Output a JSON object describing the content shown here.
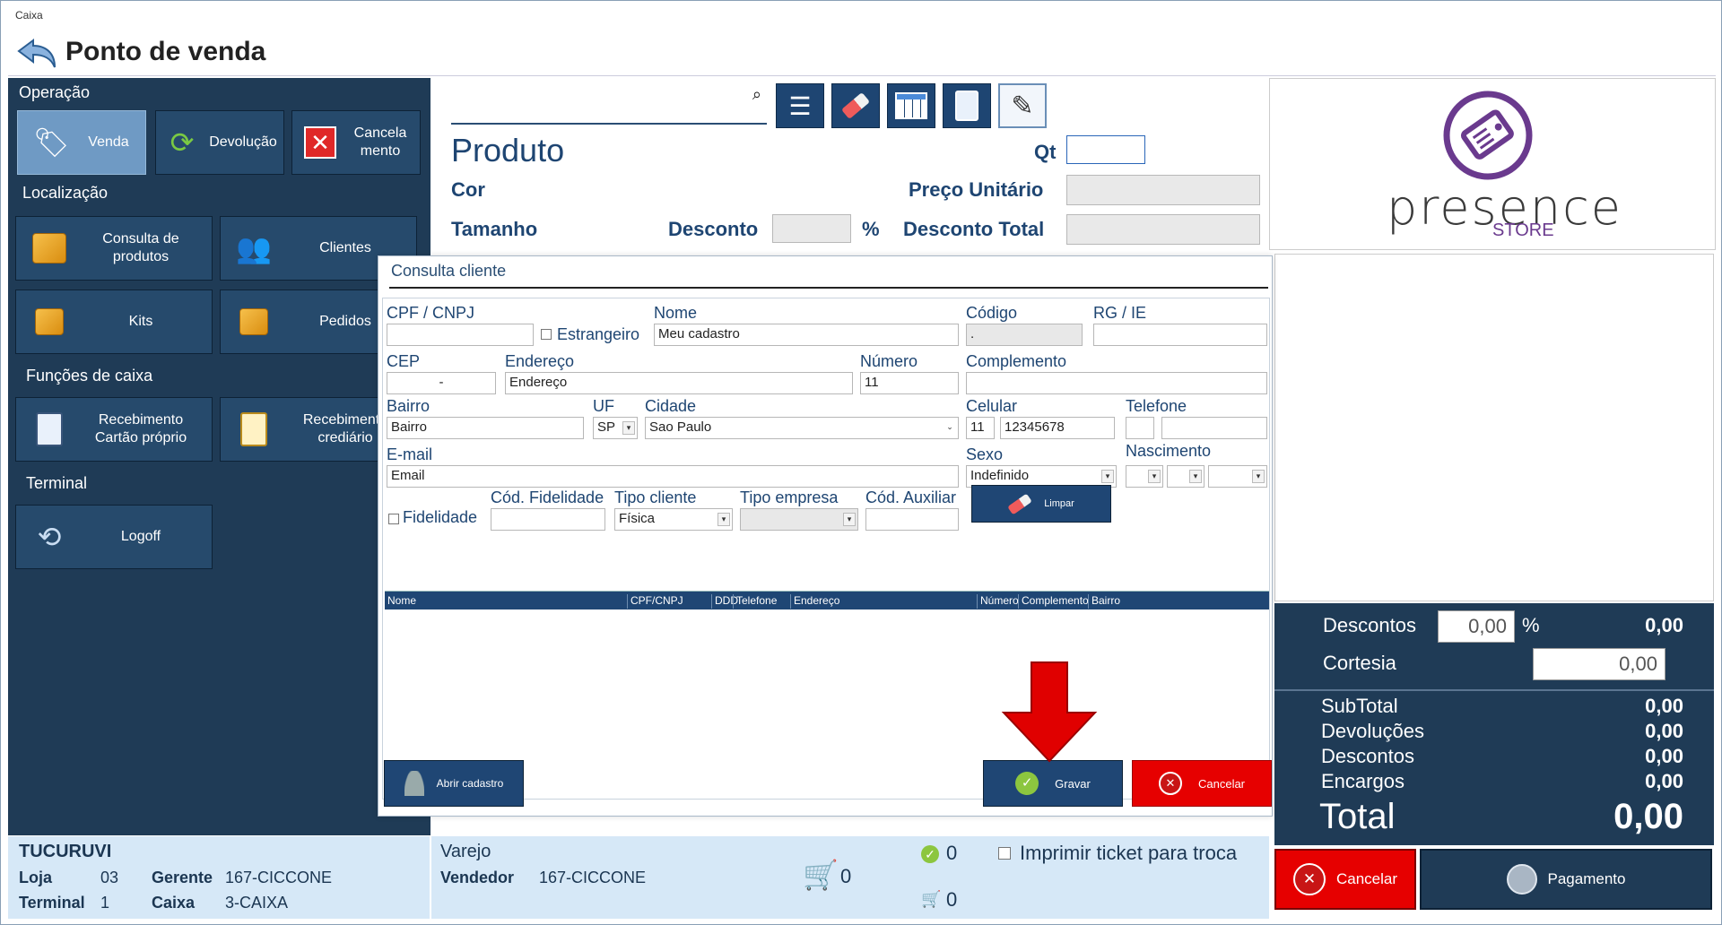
{
  "window": {
    "title": "Caixa"
  },
  "header": {
    "title": "Ponto de venda"
  },
  "left": {
    "operacao": "Operação",
    "venda": "Venda",
    "devolucao": "Devolução",
    "cancelamento_1": "Cancela",
    "cancelamento_2": "mento",
    "localizacao": "Localização",
    "consulta_1": "Consulta de",
    "consulta_2": "produtos",
    "clientes": "Clientes",
    "kits": "Kits",
    "pedidos": "Pedidos",
    "funcoes": "Funções de caixa",
    "receb_cartao_1": "Recebimento",
    "receb_cartao_2": "Cartão próprio",
    "receb_cred_1": "Recebimento",
    "receb_cred_2": "crediário",
    "terminal": "Terminal",
    "logoff": "Logoff"
  },
  "product": {
    "search_placeholder": "",
    "produto": "Produto",
    "qt": "Qt",
    "cor": "Cor",
    "preco_unitario": "Preço Unitário",
    "tamanho": "Tamanho",
    "desconto": "Desconto",
    "pct": "%",
    "desconto_total": "Desconto Total"
  },
  "logo": {
    "brand": "presence",
    "sub": "STORE",
    "color": "#6a3a8e"
  },
  "totals": {
    "descontos_label": "Descontos",
    "descontos_input": "0,00",
    "pct": "%",
    "descontos_value": "0,00",
    "cortesia_label": "Cortesia",
    "cortesia_input": "0,00",
    "subtotal_label": "SubTotal",
    "subtotal": "0,00",
    "devolucoes_label": "Devoluções",
    "devolucoes": "0,00",
    "descontos2_label": "Descontos",
    "descontos2": "0,00",
    "encargos_label": "Encargos",
    "encargos": "0,00",
    "total_label": "Total",
    "total": "0,00",
    "cancelar": "Cancelar",
    "pagamento": "Pagamento"
  },
  "footer": {
    "loja_nome": "TUCURUVI",
    "loja_label": "Loja",
    "loja": "03",
    "gerente_label": "Gerente",
    "gerente": "167-CICCONE",
    "terminal_label": "Terminal",
    "terminal": "1",
    "caixa_label": "Caixa",
    "caixa": "3-CAIXA",
    "varejo": "Varejo",
    "vendedor_label": "Vendedor",
    "vendedor": "167-CICCONE",
    "cart_count": "0",
    "ok_count": "0",
    "cart2_count": "0",
    "imprimir": "Imprimir ticket para troca"
  },
  "dialog": {
    "title": "Consulta cliente",
    "cpf_label": "CPF / CNPJ",
    "cpf": "",
    "estrangeiro": "Estrangeiro",
    "nome_label": "Nome",
    "nome": "Meu cadastro",
    "codigo_label": "Código",
    "codigo": ".",
    "rg_label": "RG / IE",
    "rg": "",
    "cep_label": "CEP",
    "cep": "-",
    "endereco_label": "Endereço",
    "endereco": "Endereço",
    "numero_label": "Número",
    "numero": "11",
    "complemento_label": "Complemento",
    "complemento": "",
    "bairro_label": "Bairro",
    "bairro": "Bairro",
    "uf_label": "UF",
    "uf": "SP",
    "cidade_label": "Cidade",
    "cidade": "Sao Paulo",
    "celular_label": "Celular",
    "celular_ddd": "11",
    "celular": "12345678",
    "telefone_label": "Telefone",
    "email_label": "E-mail",
    "email": "Email",
    "sexo_label": "Sexo",
    "sexo": "Indefinido",
    "nascimento_label": "Nascimento",
    "fidelidade": "Fidelidade",
    "cod_fid_label": "Cód. Fidelidade",
    "tipo_cliente_label": "Tipo cliente",
    "tipo_cliente": "Física",
    "tipo_empresa_label": "Tipo empresa",
    "cod_aux_label": "Cód. Auxiliar",
    "limpar": "Limpar",
    "grid_cols": [
      "Nome",
      "CPF/CNPJ",
      "DDD",
      "Telefone",
      "Endereço",
      "Número",
      "Complemento",
      "Bairro"
    ],
    "abrir_cadastro": "Abrir cadastro",
    "gravar": "Gravar",
    "cancelar": "Cancelar"
  }
}
